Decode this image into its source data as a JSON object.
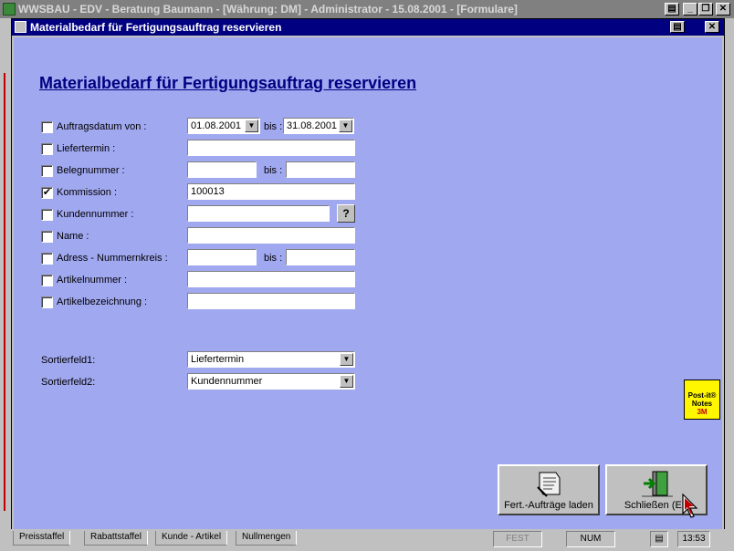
{
  "app": {
    "title": "WWSBAU - EDV - Beratung Baumann - [Währung: DM] - Administrator - 15.08.2001 - [Formulare]"
  },
  "child": {
    "title": "Materialbedarf für Fertigungsauftrag reservieren"
  },
  "form": {
    "heading": "Materialbedarf für Fertigungsauftrag reservieren",
    "bis_label": "bis :",
    "rows": [
      {
        "label": "Auftragsdatum von :",
        "checked": false,
        "from": "01.08.2001",
        "to": "31.08.2001"
      },
      {
        "label": "Liefertermin :",
        "checked": false,
        "value": ""
      },
      {
        "label": "Belegnummer :",
        "checked": false,
        "from": "",
        "to": ""
      },
      {
        "label": "Kommission :",
        "checked": true,
        "value": "100013"
      },
      {
        "label": "Kundennummer :",
        "checked": false,
        "value": ""
      },
      {
        "label": "Name :",
        "checked": false,
        "value": ""
      },
      {
        "label": "Adress - Nummernkreis :",
        "checked": false,
        "from": "",
        "to": ""
      },
      {
        "label": "Artikelnummer :",
        "checked": false,
        "value": ""
      },
      {
        "label": "Artikelbezeichnung :",
        "checked": false,
        "value": ""
      }
    ],
    "sort1": {
      "label": "Sortierfeld1:",
      "value": "Liefertermin"
    },
    "sort2": {
      "label": "Sortierfeld2:",
      "value": "Kundennummer"
    },
    "check_mark": "✔",
    "help_label": "?"
  },
  "buttons": {
    "load": "Fert.-Aufträge laden",
    "close": "Schließen (ES"
  },
  "postit": {
    "line1": "Post-it®",
    "line2": "Notes",
    "line3": "3M"
  },
  "statusbar": {
    "tabs": [
      "Preisstaffel",
      "Rabattstaffel",
      "Kunde - Artikel",
      "Nullmengen"
    ],
    "fest": "FEST",
    "num": "NUM",
    "time": "13:53"
  },
  "colors": {
    "form_bg": "#a0a8f0",
    "title_blue": "#000080"
  }
}
